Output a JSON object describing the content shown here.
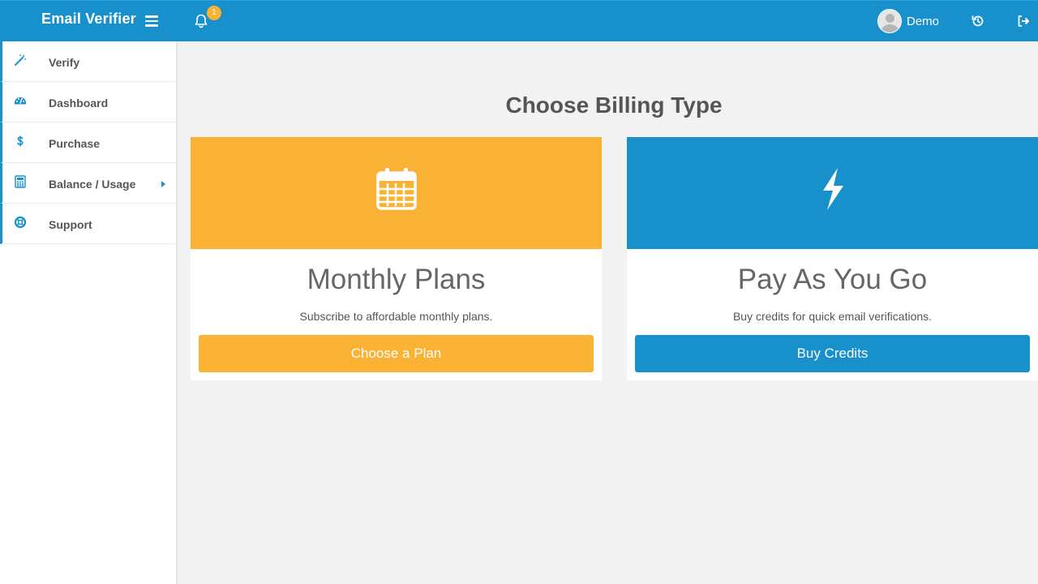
{
  "header": {
    "brand": "Email Verifier",
    "notification_count": "1",
    "user_name": "Demo",
    "bar_color": "#1790cc",
    "icons": [
      "menu-icon",
      "bell-icon",
      "user-avatar",
      "history-icon",
      "sign-out-icon"
    ]
  },
  "sidebar": {
    "items": [
      {
        "label": "Verify",
        "icon": "magic-wand-icon"
      },
      {
        "label": "Dashboard",
        "icon": "dashboard-gauge-icon"
      },
      {
        "label": "Purchase",
        "icon": "dollar-icon"
      },
      {
        "label": "Balance / Usage",
        "icon": "calculator-icon",
        "has_submenu": true
      },
      {
        "label": "Support",
        "icon": "life-ring-icon"
      }
    ]
  },
  "main": {
    "title": "Choose Billing Type",
    "cards": [
      {
        "title": "Monthly Plans",
        "description": "Subscribe to affordable monthly plans.",
        "button_label": "Choose a Plan",
        "icon": "calendar-icon",
        "color": "#f9b233"
      },
      {
        "title": "Pay As You Go",
        "description": "Buy credits for quick email verifications.",
        "button_label": "Buy Credits",
        "icon": "lightning-bolt-icon",
        "color": "#1790cc"
      }
    ]
  }
}
